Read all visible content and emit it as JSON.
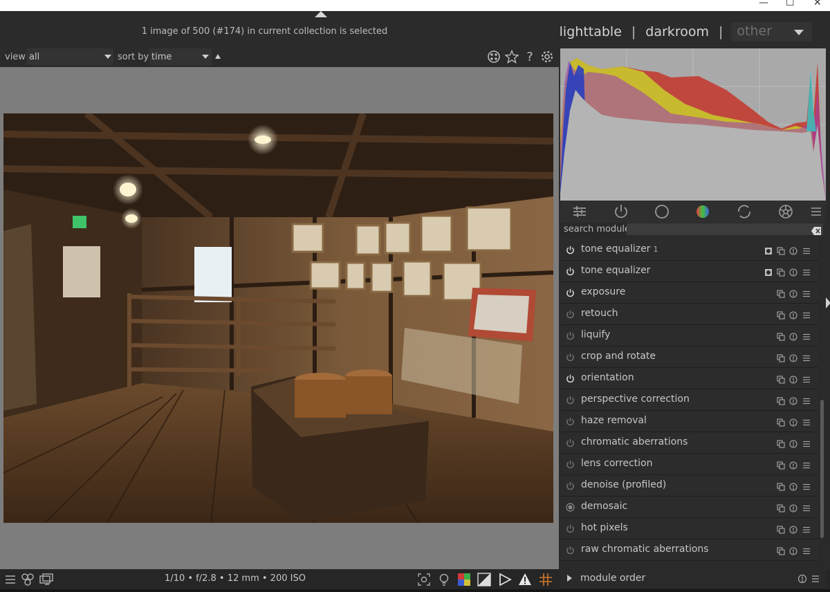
{
  "window": {
    "controls": [
      "—",
      "☐",
      "✕"
    ]
  },
  "header": {
    "status": "1 image of 500 (#174) in current collection is selected",
    "views": {
      "lighttable": "lighttable",
      "sep": "|",
      "darkroom": "darkroom",
      "other": "other"
    }
  },
  "filter": {
    "view_label": "view",
    "view_value": "all",
    "sort_label": "sort by",
    "sort_value": "time",
    "help": "?"
  },
  "search": {
    "label": "search module",
    "placeholder": ""
  },
  "modules": [
    {
      "name": "tone equalizer",
      "instance": "1",
      "power": "on",
      "mask": true
    },
    {
      "name": "tone equalizer",
      "instance": "",
      "power": "on",
      "mask": true
    },
    {
      "name": "exposure",
      "instance": "",
      "power": "on",
      "mask": false
    },
    {
      "name": "retouch",
      "instance": "",
      "power": "off",
      "mask": false
    },
    {
      "name": "liquify",
      "instance": "",
      "power": "off",
      "mask": false
    },
    {
      "name": "crop and rotate",
      "instance": "",
      "power": "off",
      "mask": false
    },
    {
      "name": "orientation",
      "instance": "",
      "power": "on",
      "mask": false
    },
    {
      "name": "perspective correction",
      "instance": "",
      "power": "off",
      "mask": false
    },
    {
      "name": "haze removal",
      "instance": "",
      "power": "off",
      "mask": false
    },
    {
      "name": "chromatic aberrations",
      "instance": "",
      "power": "off",
      "mask": false
    },
    {
      "name": "lens correction",
      "instance": "",
      "power": "off",
      "mask": false
    },
    {
      "name": "denoise (profiled)",
      "instance": "",
      "power": "off",
      "mask": false
    },
    {
      "name": "demosaic",
      "instance": "",
      "power": "always",
      "mask": false
    },
    {
      "name": "hot pixels",
      "instance": "",
      "power": "off",
      "mask": false
    },
    {
      "name": "raw chromatic aberrations",
      "instance": "",
      "power": "off",
      "mask": false
    }
  ],
  "bottom": {
    "exif": "1/10 • f/2.8 • 12 mm • 200 ISO",
    "module_order": "module order"
  },
  "colors": {
    "accent": "#c8c8c8",
    "panel": "#2a2a2a",
    "center": "#7d7d7d"
  }
}
